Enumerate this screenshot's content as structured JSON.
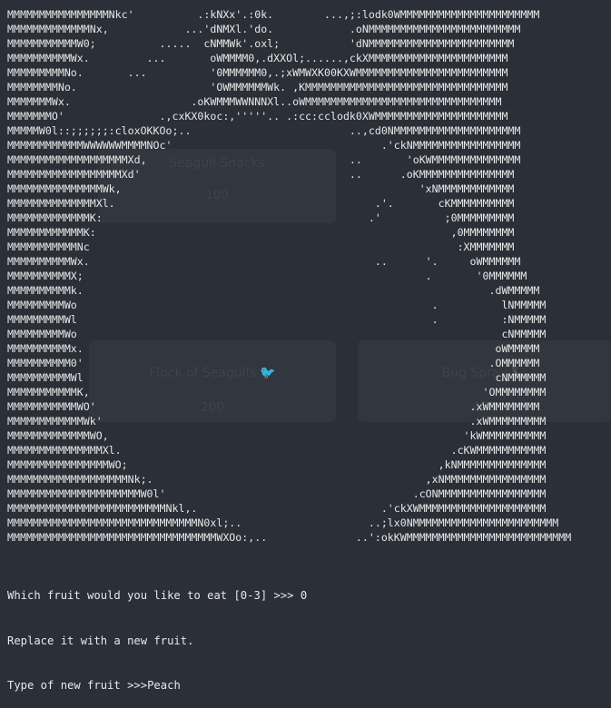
{
  "colors": {
    "background": "#2b2f37",
    "terminal_text": "#e8e8e8",
    "panel": "#32363e"
  },
  "background_ui": {
    "top_card_title": "Seagull Snacks",
    "top_card_cost": "100",
    "card_1_title": "Flock of Seagulls",
    "card_1_cost": "200",
    "card_1_icon": "bird-icon",
    "card_2_title": "Bug Spray",
    "card_2_cost": "450",
    "card_2_icon": "phone-icon"
  },
  "ascii_art": [
    "MMMMMMMMMMMMMMMMNkc'          .:kNXx'.:0k.        ...,;:lodk0WMMMMMMMMMMMMMMMMMMMMMM",
    "MMMMMMMMMMMMMNx,            ...'dNMXl.'do.            .oNMMMMMMMMMMMMMMMMMMMMMMMM",
    "MMMMMMMMMMMW0;          .....  cNMMWk'.oxl;           'dNMMMMMMMMMMMMMMMMMMMMMMM",
    "MMMMMMMMMMWx.         ...       oWMMMM0,.dXXOl;......,ckXMMMMMMMMMMMMMMMMMMMMMM",
    "MMMMMMMMMNo.       ...          '0MMMMMM0,.;xWMWXK00KXWMMMMMMMMMMMMMMMMMMMMMMMM",
    "MMMMMMMMNo.                     'OWMMMMMMWk. ,KMMMMMMMMMMMMMMMMMMMMMMMMMMMMMMMM",
    "MMMMMMMWx.                   .oKWMMMWWNNNXl..oWMMMMMMMMMMMMMMMMMMMMMMMMMMMMMMM",
    "MMMMMMMO'               .,cxKX0koc:,'''''.. .:cc:cclodk0XWMMMMMMMMMMMMMMMMMMMMM",
    "MMMMMW0l::;;;;;;:cloxOKKOo;..                         ..,cd0NMMMMMMMMMMMMMMMMMMMM",
    "MMMMMMMMMMMMWWWWWWMMMMNOc'                                 .'ckNMMMMMMMMMMMMMMMMM",
    "MMMMMMMMMMMMMMMMMMMXd,                                ..       'oKWMMMMMMMMMMMMMM",
    "MMMMMMMMMMMMMMMMMMXd'                                 ..      .oKMMMMMMMMMMMMMMM",
    "MMMMMMMMMMMMMMMWk,                                               'xNMMMMMMMMMMMM",
    "MMMMMMMMMMMMMMXl.                                         .'.       cKMMMMMMMMMM",
    "MMMMMMMMMMMMMK:                                          .'          ;0MMMMMMMMM",
    "MMMMMMMMMMMMK:                                                        ,0MMMMMMMM",
    "MMMMMMMMMMMNc                                                          :XMMMMMMM",
    "MMMMMMMMMMWx.                                             ..      '.     oWMMMMMM",
    "MMMMMMMMMMX;                                                      .       '0MMMMMM",
    "MMMMMMMMMMk.                                                                .dWMMMMM",
    "MMMMMMMMMWo                                                        .          lNMMMMM",
    "MMMMMMMMMWl                                                        .          :NMMMMM",
    "MMMMMMMMMWo                                                                   cNMMMMM",
    "MMMMMMMMMMx.                                                                 oWMMMMM",
    "MMMMMMMMMM0'                                                                .OMMMMMM",
    "MMMMMMMMMMWl                                                                 cNMMMMMM",
    "MMMMMMMMMMMK,                                                              'OMMMMMMMM",
    "MMMMMMMMMMMWO'                                                           .xWMMMMMMMM",
    "MMMMMMMMMMMMWk'                                                          .xWMMMMMMMMM",
    "MMMMMMMMMMMMMWO,                                                        'kWMMMMMMMMMM",
    "MMMMMMMMMMMMMMMXl.                                                    .cKWMMMMMMMMMMM",
    "MMMMMMMMMMMMMMMMWO;                                                 ,kNMMMMMMMMMMMMMM",
    "MMMMMMMMMMMMMMMMMMMNk;.                                           ,xNMMMMMMMMMMMMMMMM",
    "MMMMMMMMMMMMMMMMMMMMMW0l'                                       .cONMMMMMMMMMMMMMMMMM",
    "MMMMMMMMMMMMMMMMMMMMMMMMMNkl,.                             .'ckXWMMMMMMMMMMMMMMMMMMMM",
    "MMMMMMMMMMMMMMMMMMMMMMMMMMMMMMN0xl;..                    ..;lx0NMMMMMMMMMMMMMMMMMMMMMMM",
    "MMMMMMMMMMMMMMMMMMMMMMMMMMMMMMMMMWXOo:,..              ..':okKWMMMMMMMMMMMMMMMMMMMMMMMMMM"
  ],
  "prompt": {
    "question": "Which fruit would you like to eat [0-3] >>> ",
    "answer": "0",
    "replace_msg": "Replace it with a new fruit.",
    "type_prompt": "Type of new fruit >>>",
    "type_value": "Peach"
  }
}
